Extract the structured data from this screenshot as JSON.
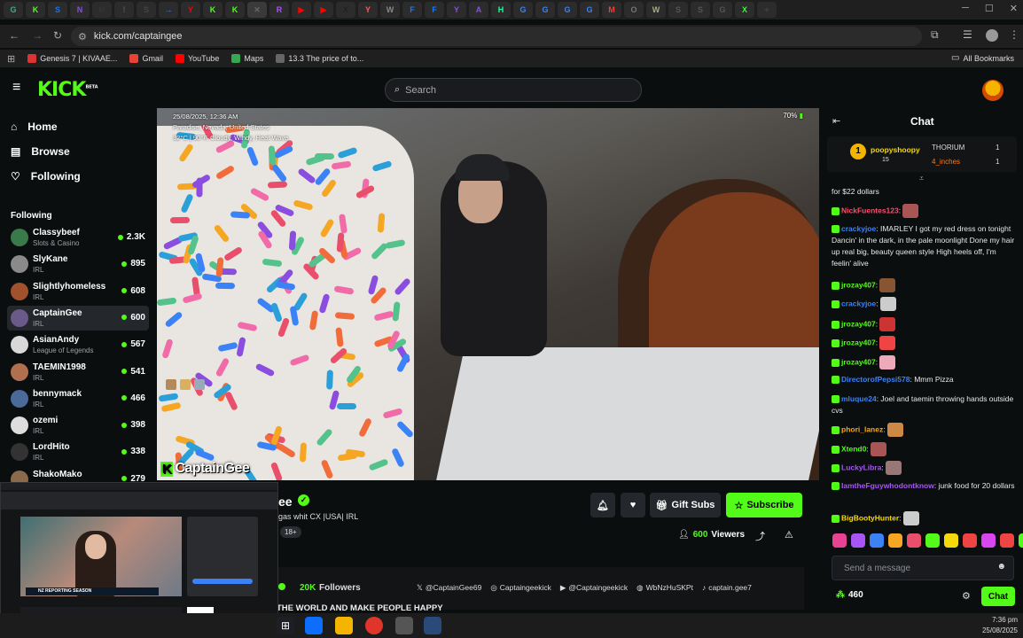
{
  "browser": {
    "tabs": [
      "G",
      "K",
      "S",
      "N",
      "M",
      "!",
      "S",
      "→",
      "Y",
      "K",
      "K",
      "✕",
      "R",
      "▶",
      "▶",
      "X",
      "Y",
      "W",
      "F",
      "F",
      "Y",
      "A",
      "H",
      "G",
      "G",
      "G",
      "G",
      "M",
      "O",
      "W",
      "S",
      "S",
      "G",
      "X",
      "+"
    ],
    "url": "kick.com/captaingee",
    "bookmarks": [
      {
        "label": "Genesis 7 | KIVAAE...",
        "color": "#d33"
      },
      {
        "label": "Gmail",
        "color": "#ea4335"
      },
      {
        "label": "YouTube",
        "color": "#ff0000"
      },
      {
        "label": "Maps",
        "color": "#34a853"
      },
      {
        "label": "13.3 The price of to...",
        "color": "#666"
      }
    ],
    "all_bookmarks": "All Bookmarks"
  },
  "header": {
    "logo": "KICK",
    "logo_beta": "BETA",
    "search_placeholder": "Search"
  },
  "sidebar": {
    "nav": [
      {
        "label": "Home",
        "icon": "home-icon"
      },
      {
        "label": "Browse",
        "icon": "browse-icon"
      },
      {
        "label": "Following",
        "icon": "heart-icon"
      }
    ],
    "following_heading": "Following",
    "channels": [
      {
        "name": "Classybeef",
        "category": "Slots & Casino",
        "viewers": "2.3K",
        "color": "#3a7a4a"
      },
      {
        "name": "SlyKane",
        "category": "IRL",
        "viewers": "895",
        "color": "#8a8a8a"
      },
      {
        "name": "Slightlyhomeless",
        "category": "IRL",
        "viewers": "608",
        "color": "#a0522d"
      },
      {
        "name": "CaptainGee",
        "category": "IRL",
        "viewers": "600",
        "color": "#6a5a8a"
      },
      {
        "name": "AsianAndy",
        "category": "League of Legends",
        "viewers": "567",
        "color": "#d8d8d8"
      },
      {
        "name": "TAEMIN1998",
        "category": "IRL",
        "viewers": "541",
        "color": "#b07050"
      },
      {
        "name": "bennymack",
        "category": "IRL",
        "viewers": "466",
        "color": "#4a6a9a"
      },
      {
        "name": "ozemi",
        "category": "IRL",
        "viewers": "398",
        "color": "#dddddd"
      },
      {
        "name": "LordHito",
        "category": "IRL",
        "viewers": "338",
        "color": "#333333"
      },
      {
        "name": "ShakoMako",
        "category": "",
        "viewers": "279",
        "color": "#8a6a4a"
      }
    ]
  },
  "video": {
    "timestamp": "25/08/2025, 12:36 AM",
    "location": "Paradise, Nevada, United States",
    "weather": "32°C | 90°F, Cloudy, Windy, Heat Wave",
    "battery": "70%",
    "watermark": "CaptainGee"
  },
  "stream": {
    "title_fragment": "ee",
    "subtitle": "gas whit CX  |USA| IRL",
    "age_badge": "18+",
    "followers": "20K",
    "followers_label": "Followers",
    "viewers": "600",
    "viewers_label": "Viewers",
    "gift_subs": "Gift Subs",
    "subscribe": "Subscribe",
    "about_text": "THE WORLD AND MAKE PEOPLE HAPPY",
    "socials": [
      {
        "icon": "x-icon",
        "label": "@CaptainGee69"
      },
      {
        "icon": "instagram-icon",
        "label": "Captaingeekick"
      },
      {
        "icon": "youtube-icon",
        "label": "@Captaingeekick"
      },
      {
        "icon": "discord-icon",
        "label": "WbNzHuSKPt"
      },
      {
        "icon": "tiktok-icon",
        "label": "captain.gee7"
      }
    ]
  },
  "chat": {
    "title": "Chat",
    "pinned": {
      "user": "poopyshoopy",
      "sub_count": "15",
      "gifter1": "THORIUM",
      "gifter1_count": "1",
      "gifter2": "4_inches",
      "gifter2_count": "1"
    },
    "messages": [
      {
        "user": "",
        "color": "#e8e8e8",
        "text": "for $22 dollars"
      },
      {
        "user": "NickFuentes123",
        "color": "#ff4d6d",
        "text": ""
      },
      {
        "user": "crackyjoe",
        "color": "#3b82f6",
        "text": "IMARLEY I got my red dress on tonight Dancin' in the dark, in the pale moonlight Done my hair up real big, beauty queen style High heels off, I'm feelin' alive"
      },
      {
        "user": "jrozay407",
        "color": "#53fc18",
        "text": ""
      },
      {
        "user": "crackyjoe",
        "color": "#3b82f6",
        "text": ""
      },
      {
        "user": "jrozay407",
        "color": "#53fc18",
        "text": ""
      },
      {
        "user": "jrozay407",
        "color": "#53fc18",
        "text": ""
      },
      {
        "user": "jrozay407",
        "color": "#53fc18",
        "text": ""
      },
      {
        "user": "DirectorofPepsi578",
        "color": "#3b82f6",
        "text": "Mmm Pizza"
      },
      {
        "user": "mluque24",
        "color": "#3b82f6",
        "text": "Joel and taemin throwing hands outside cvs"
      },
      {
        "user": "phori_lanez",
        "color": "#f5a623",
        "text": ""
      },
      {
        "user": "Xtend0",
        "color": "#53fc18",
        "text": ""
      },
      {
        "user": "LuckyLibra",
        "color": "#a855f7",
        "text": ""
      },
      {
        "user": "IamtheFguywhodontknow",
        "color": "#a855f7",
        "text": "junk food for 20 dollars"
      },
      {
        "user": "BigBootyHunter",
        "color": "#f5d90a",
        "text": ""
      }
    ],
    "input_placeholder": "Send a message",
    "points": "460",
    "send_label": "Chat"
  },
  "taskbar": {
    "time": "7:36 pm",
    "date": "25/08/2025"
  },
  "overlay": {
    "banner": "NZ REPORTING SEASON"
  },
  "colors": {
    "accent": "#53fc18",
    "bg": "#0b0e0f"
  }
}
